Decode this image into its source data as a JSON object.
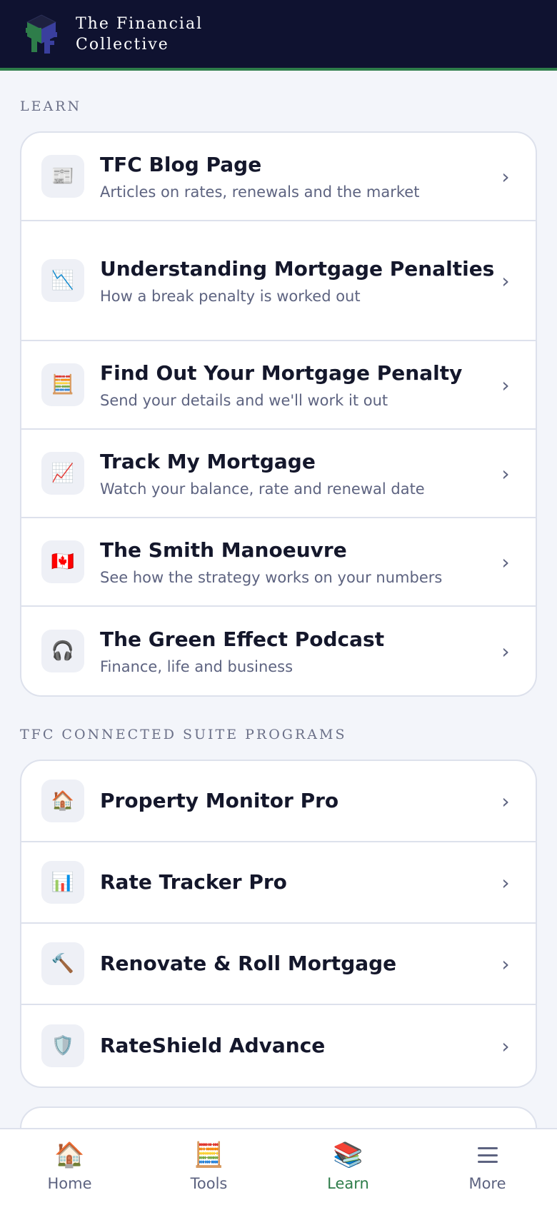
{
  "header": {
    "brand_line1": "The Financial",
    "brand_line2": "Collective",
    "logo_icon": "tfc-cube-logo-icon"
  },
  "colors": {
    "header_bg": "#0f1230",
    "accent_green": "#2e7d4a",
    "page_bg": "#f3f5fa"
  },
  "learn": {
    "label": "LEARN",
    "items": [
      {
        "icon": "newspaper-icon",
        "glyph": "📰",
        "title": "TFC Blog Page",
        "subtitle": "Articles on rates, renewals and the market"
      },
      {
        "icon": "chart-decreasing-icon",
        "glyph": "📉",
        "title": "Understanding Mortgage Penalties",
        "subtitle": "How a break penalty is worked out"
      },
      {
        "icon": "abacus-icon",
        "glyph": "🧮",
        "title": "Find Out Your Mortgage Penalty",
        "subtitle": "Send your details and we'll work it out"
      },
      {
        "icon": "chart-increasing-icon",
        "glyph": "📈",
        "title": "Track My Mortgage",
        "subtitle": "Watch your balance, rate and renewal date"
      },
      {
        "icon": "canada-flag-icon",
        "glyph": "🇨🇦",
        "title": "The Smith Manoeuvre",
        "subtitle": "See how the strategy works on your numbers"
      },
      {
        "icon": "headphones-icon",
        "glyph": "🎧",
        "title": "The Green Effect Podcast",
        "subtitle": "Finance, life and business"
      }
    ]
  },
  "suite": {
    "label": "TFC CONNECTED SUITE PROGRAMS",
    "items": [
      {
        "icon": "house-icon",
        "glyph": "🏠",
        "title": "Property Monitor Pro"
      },
      {
        "icon": "bar-chart-icon",
        "glyph": "📊",
        "title": "Rate Tracker Pro"
      },
      {
        "icon": "hammer-icon",
        "glyph": "🔨",
        "title": "Renovate & Roll Mortgage"
      },
      {
        "icon": "shield-icon",
        "glyph": "🛡️",
        "title": "RateShield Advance"
      }
    ]
  },
  "chevron": "›",
  "tabbar": {
    "tabs": [
      {
        "icon": "home-icon",
        "glyph": "🏠",
        "label": "Home",
        "active": false
      },
      {
        "icon": "tools-abacus-icon",
        "glyph": "🧮",
        "label": "Tools",
        "active": false
      },
      {
        "icon": "books-icon",
        "glyph": "📚",
        "label": "Learn",
        "active": true
      },
      {
        "icon": "menu-icon",
        "glyph": "",
        "label": "More",
        "active": false
      }
    ]
  }
}
